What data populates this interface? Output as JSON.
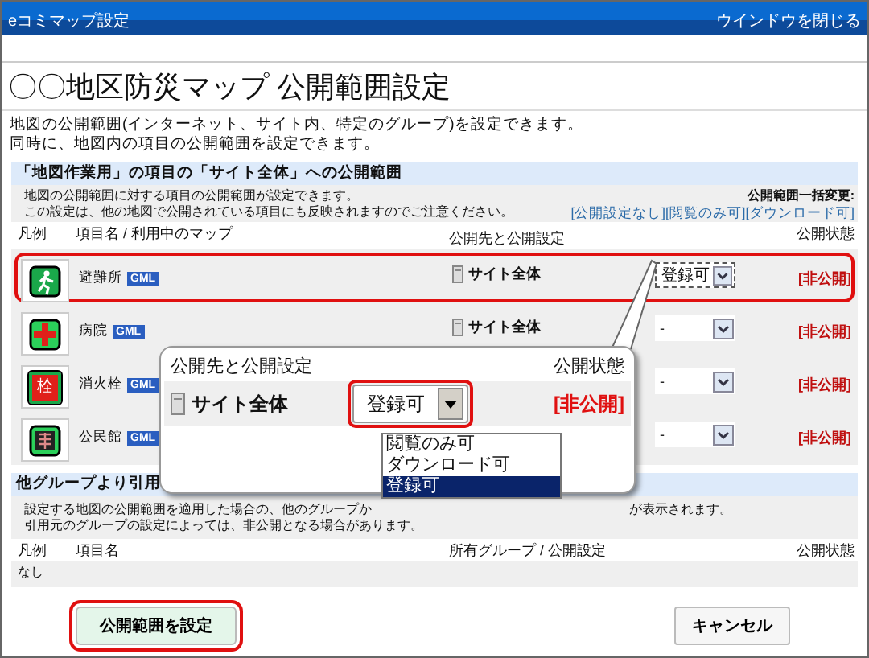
{
  "window": {
    "title": "eコミマップ設定",
    "close_link": "ウインドウを閉じる"
  },
  "heading": "〇〇地区防災マップ 公開範囲設定",
  "intro": [
    "地図の公開範囲(インターネット、サイト内、特定のグループ)を設定できます。",
    "同時に、地図内の項目の公開範囲を設定できます。"
  ],
  "section1": {
    "title": "「地図作業用」の項目の「サイト全体」への公開範囲",
    "description": [
      "地図の公開範囲に対する項目の公開範囲が設定できます。",
      "この設定は、他の地図で公開されている項目にも反映されますのでご注意ください。"
    ],
    "bulk_label": "公開範囲一括変更:",
    "bulk_links": [
      "[公開設定なし]",
      "[閲覧のみ可]",
      "[ダウンロード可]"
    ],
    "columns": [
      "凡例",
      "項目名 / 利用中のマップ",
      "公開先と公開設定",
      "公開状態"
    ],
    "rows": [
      {
        "kind": "exit",
        "name": "避難所",
        "badge": "GML",
        "target": "サイト全体",
        "setting": "登録可",
        "status": "[非公開]",
        "highlighted": true
      },
      {
        "kind": "hospital",
        "name": "病院",
        "badge": "GML",
        "target": "サイト全体",
        "setting": "-",
        "status": "[非公開]",
        "highlighted": false
      },
      {
        "kind": "hydrant",
        "icon_text": "栓",
        "name": "消火栓",
        "badge": "GML",
        "setting": "-",
        "status": "[非公開]",
        "highlighted": false
      },
      {
        "kind": "hall",
        "name": "公民館",
        "badge": "GML",
        "setting": "-",
        "status": "[非公開]",
        "highlighted": false
      }
    ]
  },
  "section2": {
    "title": "他グループより引用",
    "description": [
      [
        "設定する地図の公開範囲を適用した場合の、他のグループか",
        "が表示されます。"
      ],
      [
        "引用元のグループの設定によっては、非公開となる場合があります。"
      ]
    ],
    "columns": [
      "凡例",
      "項目名",
      "所有グループ / 公開設定",
      "公開状態"
    ],
    "rows": [
      {
        "text": "なし"
      }
    ]
  },
  "callout": {
    "columns": [
      "公開先と公開設定",
      "公開状態"
    ],
    "target": "サイト全体",
    "setting": "登録可",
    "status": "[非公開]",
    "options": [
      {
        "label": "閲覧のみ可",
        "selected": false
      },
      {
        "label": "ダウンロード可",
        "selected": false
      },
      {
        "label": "登録可",
        "selected": true
      }
    ]
  },
  "buttons": [
    {
      "label": "公開範囲を設定",
      "highlighted": true
    },
    {
      "label": "キャンセル",
      "highlighted": false
    }
  ]
}
